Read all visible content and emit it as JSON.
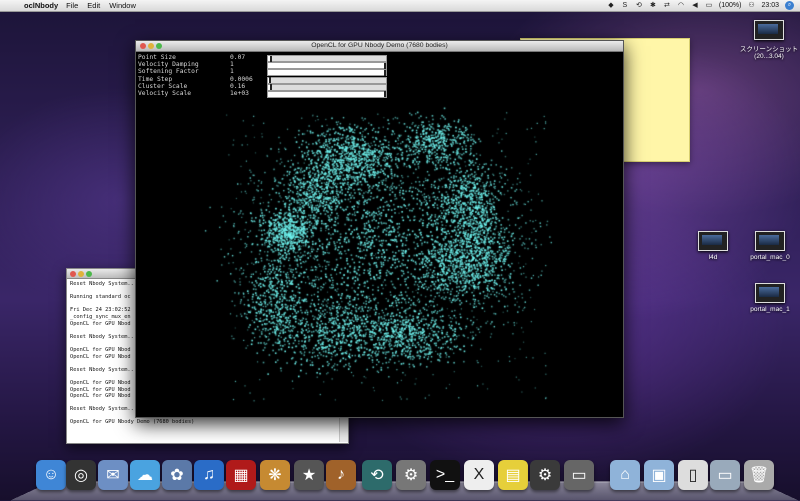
{
  "menubar": {
    "apple_glyph": "",
    "app_name": "oclNbody",
    "menus": [
      "File",
      "Edit",
      "Window"
    ],
    "battery": "(100%)",
    "clock": "23:03"
  },
  "nbody_window": {
    "title": "OpenCL for GPU Nbody Demo (7680 bodies)",
    "params": [
      {
        "name": "Point Size",
        "value": "0.07",
        "level": 0.02
      },
      {
        "name": "Velocity Damping",
        "value": "1",
        "level": 1.0
      },
      {
        "name": "Softening Factor",
        "value": "1",
        "level": 1.0
      },
      {
        "name": "Time Step",
        "value": "0.0006",
        "level": 0.01
      },
      {
        "name": "Cluster Scale",
        "value": "0.16",
        "level": 0.02
      },
      {
        "name": "Velocity Scale",
        "value": "1e+03",
        "level": 1.0
      }
    ],
    "particle_color": "#6ff5f0"
  },
  "terminal": {
    "lines": [
      "Reset Nbody System...",
      "",
      "Running standard oc",
      "",
      "Fri Dec 24 23:02:52",
      "_config_sync_mux_en",
      "OpenCL for GPU Nbod",
      "",
      "Reset Nbody System...",
      "",
      "OpenCL for GPU Nbod",
      "OpenCL for GPU Nbod",
      "",
      "Reset Nbody System...",
      "",
      "OpenCL for GPU Nbod",
      "OpenCL for GPU Nbod",
      "OpenCL for GPU Nbod",
      "",
      "Reset Nbody System...",
      "",
      "OpenCL for GPU Nbody Demo (7680 bodies)"
    ]
  },
  "desktop": {
    "icons": [
      {
        "label": "スクリーンショット (20...3.04)"
      },
      {
        "label": "l4d"
      },
      {
        "label": "portal_mac_0"
      },
      {
        "label": "portal_mac_1"
      }
    ]
  },
  "dock": {
    "items": [
      {
        "name": "finder-icon",
        "glyph": "☺",
        "color": "#3f86d6"
      },
      {
        "name": "dashboard-icon",
        "glyph": "◎",
        "color": "#333"
      },
      {
        "name": "mail-icon",
        "glyph": "✉",
        "color": "#6d8fc4"
      },
      {
        "name": "ichat-icon",
        "glyph": "☁",
        "color": "#4aa3e0"
      },
      {
        "name": "iphoto-icon",
        "glyph": "✿",
        "color": "#5b79a8"
      },
      {
        "name": "itunes-icon",
        "glyph": "♫",
        "color": "#2a6cc7"
      },
      {
        "name": "photobooth-icon",
        "glyph": "▦",
        "color": "#b01a1a"
      },
      {
        "name": "iphoto2-icon",
        "glyph": "❋",
        "color": "#c68a32"
      },
      {
        "name": "imovie-icon",
        "glyph": "★",
        "color": "#555"
      },
      {
        "name": "garageband-icon",
        "glyph": "♪",
        "color": "#a0622a"
      },
      {
        "name": "timemachine-icon",
        "glyph": "⟲",
        "color": "#2d6b6b"
      },
      {
        "name": "system-preferences-icon",
        "glyph": "⚙",
        "color": "#777"
      },
      {
        "name": "terminal-icon",
        "glyph": ">_",
        "color": "#111"
      },
      {
        "name": "x11-icon",
        "glyph": "X",
        "color": "#eee"
      },
      {
        "name": "stickies-icon",
        "glyph": "▤",
        "color": "#e6cf3a"
      },
      {
        "name": "steam-icon",
        "glyph": "⚙",
        "color": "#3a3a3a"
      },
      {
        "name": "app-window-icon",
        "glyph": "▭",
        "color": "#666"
      },
      {
        "name": "applications-folder-icon",
        "glyph": "⌂",
        "color": "#8fb3d9"
      },
      {
        "name": "documents-folder-icon",
        "glyph": "▣",
        "color": "#8fb3d9"
      },
      {
        "name": "document-icon",
        "glyph": "▯",
        "color": "#ddd"
      },
      {
        "name": "screenshot-icon",
        "glyph": "▭",
        "color": "#9ab"
      },
      {
        "name": "trash-icon",
        "glyph": "🗑",
        "color": "#aaa"
      }
    ]
  }
}
